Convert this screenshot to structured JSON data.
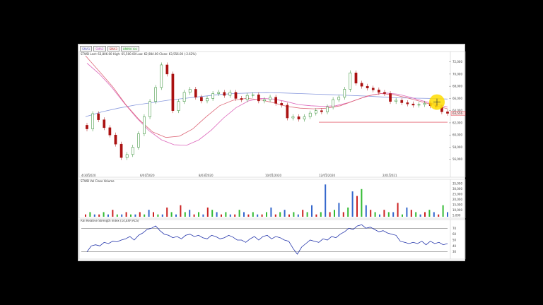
{
  "legend": [
    {
      "label": "SMA1",
      "color": "#6666cc"
    },
    {
      "label": "SMA2",
      "color": "#cc66cc"
    },
    {
      "label": "SMA3",
      "color": "#cc3333"
    },
    {
      "label": "HMMA Vol",
      "color": "#33aa33"
    }
  ],
  "price_caption": "STWD  Last: 63,806.00   High: 65,500.00   Low: 62,984.00   Close: 63,556.00  (-2.62%)",
  "volume_caption": "STWD  Vol  Close  Volume",
  "rsi_caption": "RSI  Relative Strength Index (14,EXP,ACS)",
  "chart_data": {
    "type": "candlestick",
    "price_axis": {
      "ticks": [
        "72,000",
        "70,000",
        "68,000",
        "66,000",
        "64,000",
        "62,000",
        "60,000",
        "58,000",
        "56,000"
      ],
      "ylim": [
        54000,
        73000
      ]
    },
    "date_ticks": [
      "4/30/2020",
      "6/01/2020",
      "8/03/2020",
      "10/01/2020",
      "12/01/2020",
      "2/01/2021"
    ],
    "last_price_label": "63,556",
    "support_level": 62100,
    "price_path": [
      61000,
      63500,
      62500,
      61200,
      60000,
      58500,
      56300,
      56800,
      58000,
      60200,
      63000,
      65500,
      67800,
      71500,
      70000,
      64000,
      65500,
      67000,
      67500,
      66200,
      65600,
      66000,
      66800,
      67000,
      66500,
      67000,
      66000,
      65800,
      66500,
      66600,
      65600,
      65800,
      66200,
      65200,
      64900,
      62800,
      63000,
      62600,
      63000,
      63600,
      64000,
      63800,
      64600,
      65800,
      66200,
      67500,
      70200,
      68500,
      68000,
      67700,
      67400,
      67000,
      66800,
      65500,
      65700,
      65300,
      65100,
      64900,
      65000,
      65200,
      64800,
      64600,
      63800,
      63556
    ],
    "sma_long": [
      63000,
      63800,
      64400,
      64900,
      65300,
      65700,
      66000,
      66300,
      66600,
      66800,
      66900,
      66950,
      66900,
      66800,
      66700,
      66600,
      66500,
      66400,
      66250,
      66100,
      66050,
      66000,
      65900
    ],
    "sma_mid": [
      71800,
      70000,
      67800,
      65200,
      62800,
      60700,
      59200,
      58400,
      58300,
      59200,
      60800,
      62800,
      64500,
      65600,
      66000,
      65900,
      65500,
      65000,
      64800,
      64700,
      64800,
      65300,
      66000,
      66600,
      66900,
      66700,
      66200,
      65600,
      65100,
      64600
    ],
    "sma_short": [
      73000,
      70500,
      68000,
      65000,
      62500,
      60500,
      59600,
      59800,
      61000,
      63000,
      64800,
      65700,
      66000,
      65800,
      65300,
      64700,
      64400,
      64300,
      64400,
      64800,
      65600,
      66400,
      66800,
      66600,
      66100,
      65500,
      64900,
      64300
    ],
    "volume": [
      1,
      2,
      1,
      1,
      2,
      1,
      3,
      1,
      1,
      2,
      1,
      1,
      2,
      1,
      3,
      2,
      1,
      1,
      4,
      2,
      1,
      5,
      2,
      3,
      1,
      2,
      1,
      4,
      3,
      2,
      1,
      2,
      1,
      1,
      3,
      2,
      1,
      2,
      1,
      1,
      2,
      4,
      1,
      2,
      3,
      1,
      2,
      1,
      3,
      2,
      5,
      1,
      2,
      14,
      2,
      3,
      6,
      2,
      4,
      11,
      9,
      12,
      5,
      3,
      2,
      1,
      3,
      2,
      2,
      6,
      1,
      4,
      3,
      2,
      1,
      2,
      3,
      2,
      1,
      5,
      2
    ],
    "volume_axis": {
      "ticks": [
        "35,000",
        "30,000",
        "25,000",
        "20,000",
        "15,000",
        "10,000",
        "5,000"
      ]
    },
    "rsi_axis": {
      "ticks": [
        "70",
        "60",
        "50",
        "40",
        "30"
      ],
      "levels": [
        70,
        30
      ]
    },
    "rsi": [
      30,
      40,
      42,
      40,
      46,
      44,
      48,
      47,
      50,
      52,
      56,
      50,
      58,
      62,
      68,
      70,
      74,
      66,
      60,
      58,
      54,
      56,
      52,
      58,
      60,
      56,
      58,
      54,
      52,
      58,
      56,
      52,
      54,
      58,
      55,
      50,
      50,
      46,
      52,
      56,
      50,
      56,
      58,
      52,
      56,
      54,
      50,
      48,
      36,
      26,
      38,
      44,
      50,
      48,
      46,
      52,
      50,
      56,
      54,
      60,
      64,
      70,
      68,
      74,
      76,
      70,
      72,
      68,
      64,
      66,
      62,
      60,
      58,
      48,
      46,
      44,
      46,
      44,
      48,
      42,
      48,
      44,
      46,
      42,
      44
    ]
  }
}
